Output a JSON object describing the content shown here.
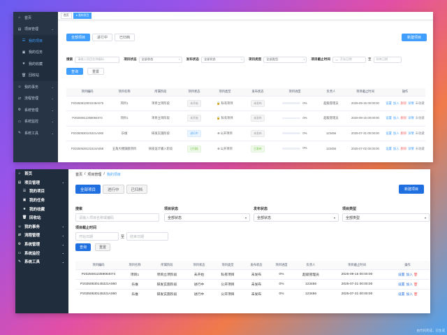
{
  "shot1": {
    "sidebar": [
      {
        "label": "首页",
        "icon": "home-icon",
        "sub": false,
        "arrow": false,
        "active": false
      },
      {
        "label": "项目管理",
        "icon": "folder-icon",
        "sub": false,
        "arrow": true,
        "active": false
      },
      {
        "label": "我的项目",
        "icon": "list-icon",
        "sub": true,
        "arrow": false,
        "active": true
      },
      {
        "label": "我的任务",
        "icon": "task-icon",
        "sub": true,
        "arrow": false,
        "active": false
      },
      {
        "label": "我的收藏",
        "icon": "star-icon",
        "sub": true,
        "arrow": false,
        "active": false
      },
      {
        "label": "回收站",
        "icon": "trash-icon",
        "sub": true,
        "arrow": false,
        "active": false
      },
      {
        "label": "我的事务",
        "icon": "user-icon",
        "sub": false,
        "arrow": true,
        "active": false
      },
      {
        "label": "流程管理",
        "icon": "flow-icon",
        "sub": false,
        "arrow": true,
        "active": false
      },
      {
        "label": "系统管理",
        "icon": "gear-icon",
        "sub": false,
        "arrow": true,
        "active": false
      },
      {
        "label": "系统监控",
        "icon": "monitor-icon",
        "sub": false,
        "arrow": true,
        "active": false
      },
      {
        "label": "系统工具",
        "icon": "tool-icon",
        "sub": false,
        "arrow": true,
        "active": false
      }
    ],
    "tags": [
      "首页",
      "● 我的项目"
    ],
    "tabs": [
      "全部项目",
      "进行中",
      "已归档"
    ],
    "new_button": "新建项目",
    "filter": {
      "search_label": "搜索",
      "search_placeholder": "请输入项目名称编码",
      "status_label": "项目状态",
      "status_value": "全部状态",
      "publish_label": "发布状态",
      "publish_value": "全部状态",
      "type_label": "项目类型",
      "type_value": "全部类型",
      "deadline_label": "项目截止时间",
      "start_placeholder": "开始日期",
      "to": "至",
      "end_placeholder": "结束日期",
      "query": "查询",
      "reset": "重置"
    },
    "table": {
      "headers": [
        "项目编码",
        "项目名称",
        "所属阶段",
        "项目状态",
        "项目类型",
        "发布状态",
        "项目进度",
        "负责人",
        "项目截止时间",
        "操作"
      ],
      "rows": [
        {
          "code": "P20250812002249A075",
          "name": "项目1",
          "stage": "项目立项阶段",
          "status": "未开始",
          "status_style": "",
          "type": "私有项目",
          "publish": "未发布",
          "publish_style": "",
          "progress": "0%",
          "owner": "超级管理员",
          "deadline": "2025-09-15 00:00:00",
          "ops": [
            "设置",
            "加入",
            "删除",
            "详情",
            "未收藏"
          ]
        },
        {
          "code": "P20250812359084074",
          "name": "项目1",
          "stage": "项目立项阶段",
          "status": "未开始",
          "status_style": "",
          "type": "私有项目",
          "publish": "未发布",
          "publish_style": "",
          "progress": "0%",
          "owner": "超级管理员",
          "deadline": "2025-09-15 00:00:00",
          "ops": [
            "设置",
            "加入",
            "删除",
            "详情",
            "未收藏"
          ]
        },
        {
          "code": "P20250630145321A060",
          "name": "乐维",
          "stage": "研发实施阶段",
          "status": "进行中",
          "status_style": "primary",
          "type": "公开项目",
          "publish": "未发布",
          "publish_style": "",
          "progress": "0%",
          "owner": "123456",
          "deadline": "2025-07-31 00:00:00",
          "ops": [
            "设置",
            "加入",
            "删除",
            "详情",
            "未收藏"
          ]
        },
        {
          "code": "P20250628132424A058",
          "name": "五角大楼旗舰项目",
          "stage": "研发设计输入阶段",
          "status": "已归档",
          "status_style": "success",
          "type": "公开项目",
          "publish": "已发布",
          "publish_style": "success",
          "progress": "0%",
          "owner": "123456",
          "deadline": "2025-07-02 00:00:00",
          "ops": [
            "设置",
            "加入",
            "删除",
            "详情",
            "未收藏"
          ]
        }
      ]
    }
  },
  "shot2": {
    "sidebar": [
      {
        "label": "首页",
        "icon": "home-icon",
        "sub": false,
        "arrow": false
      },
      {
        "label": "项目管理",
        "icon": "folder-icon",
        "sub": false,
        "arrow": true
      },
      {
        "label": "我的项目",
        "icon": "list-icon",
        "sub": true,
        "arrow": false
      },
      {
        "label": "我的任务",
        "icon": "task-icon",
        "sub": true,
        "arrow": false
      },
      {
        "label": "我的收藏",
        "icon": "star-icon",
        "sub": true,
        "arrow": false
      },
      {
        "label": "回收站",
        "icon": "trash-icon",
        "sub": true,
        "arrow": false
      },
      {
        "label": "我的事务",
        "icon": "user-icon",
        "sub": false,
        "arrow": true
      },
      {
        "label": "流程管理",
        "icon": "flow-icon",
        "sub": false,
        "arrow": true
      },
      {
        "label": "系统管理",
        "icon": "gear-icon",
        "sub": false,
        "arrow": true
      },
      {
        "label": "系统监控",
        "icon": "monitor-icon",
        "sub": false,
        "arrow": true
      },
      {
        "label": "系统工具",
        "icon": "tool-icon",
        "sub": false,
        "arrow": true
      }
    ],
    "breadcrumb": [
      "首页",
      "/",
      "项目管理",
      "/",
      "我的项目"
    ],
    "tabs": [
      "全部项目",
      "进行中",
      "已归档"
    ],
    "new_button": "新建项目",
    "filter": {
      "search_label": "搜索",
      "search_placeholder": "请输入项目名称或编码",
      "status_label": "项目状态",
      "status_value": "全部状态",
      "publish_label": "发布状态",
      "publish_value": "全部状态",
      "type_label": "项目类型",
      "type_value": "全部类型",
      "deadline_label": "项目截止时间",
      "start_placeholder": "开始日期",
      "to": "至",
      "end_placeholder": "结束日期",
      "query": "查询",
      "reset": "重置"
    },
    "table": {
      "headers": [
        "项目编码",
        "项目名称",
        "所属阶段",
        "项目状态",
        "项目类型",
        "发布状态",
        "项目进度",
        "负责人",
        "项目截止时间",
        "操作"
      ],
      "rows": [
        {
          "code": "P20250812359084074",
          "name": "项目1",
          "stage": "项目立项阶段",
          "status": "未开始",
          "type": "私有项目",
          "publish": "未发布",
          "progress": "0%",
          "owner": "超级管理员",
          "deadline": "2025-09-15 00:00:00",
          "ops": [
            "设置",
            "加入"
          ]
        },
        {
          "code": "P20250630145321A060",
          "name": "乐维",
          "stage": "研发实施阶段",
          "status": "进行中",
          "type": "公开项目",
          "publish": "未发布",
          "progress": "0%",
          "owner": "123456",
          "deadline": "2025-07-31 00:00:00",
          "ops": [
            "设置",
            "加入"
          ]
        },
        {
          "code": "P20250630145321A060",
          "name": "乐维",
          "stage": "研发实施阶段",
          "status": "进行中",
          "type": "公开项目",
          "publish": "未发布",
          "progress": "0%",
          "owner": "123456",
          "deadline": "2025-07-31 00:00:00",
          "ops": [
            "设置",
            "加入"
          ]
        }
      ]
    }
  },
  "watermark": "由代码完成，已生成"
}
